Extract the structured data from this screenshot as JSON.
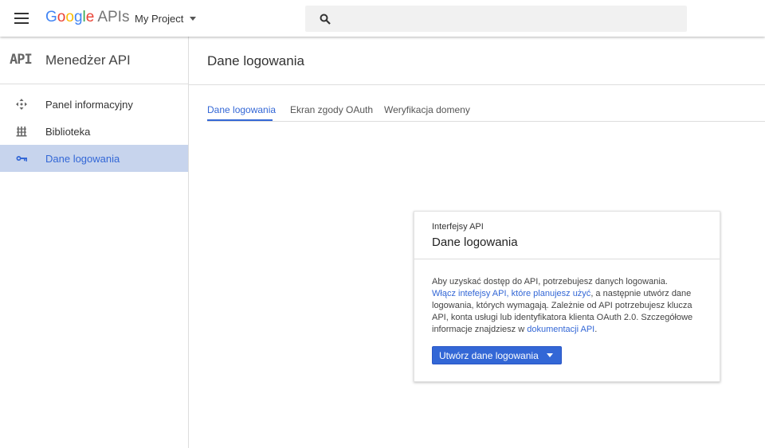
{
  "topbar": {
    "logo_parts": [
      "G",
      "o",
      "o",
      "g",
      "l",
      "e"
    ],
    "apis_label": "APIs",
    "project_label": "My Project"
  },
  "sidebar": {
    "badge": "API",
    "title": "Menedżer API",
    "items": [
      {
        "label": "Panel informacyjny",
        "icon": "dashboard-icon",
        "active": false
      },
      {
        "label": "Biblioteka",
        "icon": "library-icon",
        "active": false
      },
      {
        "label": "Dane logowania",
        "icon": "key-icon",
        "active": true
      }
    ]
  },
  "main": {
    "title": "Dane logowania",
    "tabs": [
      {
        "label": "Dane logowania",
        "active": true
      },
      {
        "label": "Ekran zgody OAuth",
        "active": false
      },
      {
        "label": "Weryfikacja domeny",
        "active": false
      }
    ]
  },
  "card": {
    "subtitle": "Interfejsy API",
    "title": "Dane logowania",
    "text_1": "Aby uzyskać dostęp do API, potrzebujesz danych logowania.",
    "link_1": "Włącz intefejsy API, które planujesz użyć",
    "text_2": ", a następnie utwórz dane logowania, których wymagają. Zależnie od API potrzebujesz klucza API, konta usługi lub identyfikatora klienta OAuth 2.0. Szczegółowe informacje znajdziesz w ",
    "link_2": "dokumentacji API",
    "text_3": ".",
    "button_label": "Utwórz dane logowania"
  },
  "colors": {
    "accent": "#3367d6",
    "active_bg": "#c7d4ed"
  }
}
